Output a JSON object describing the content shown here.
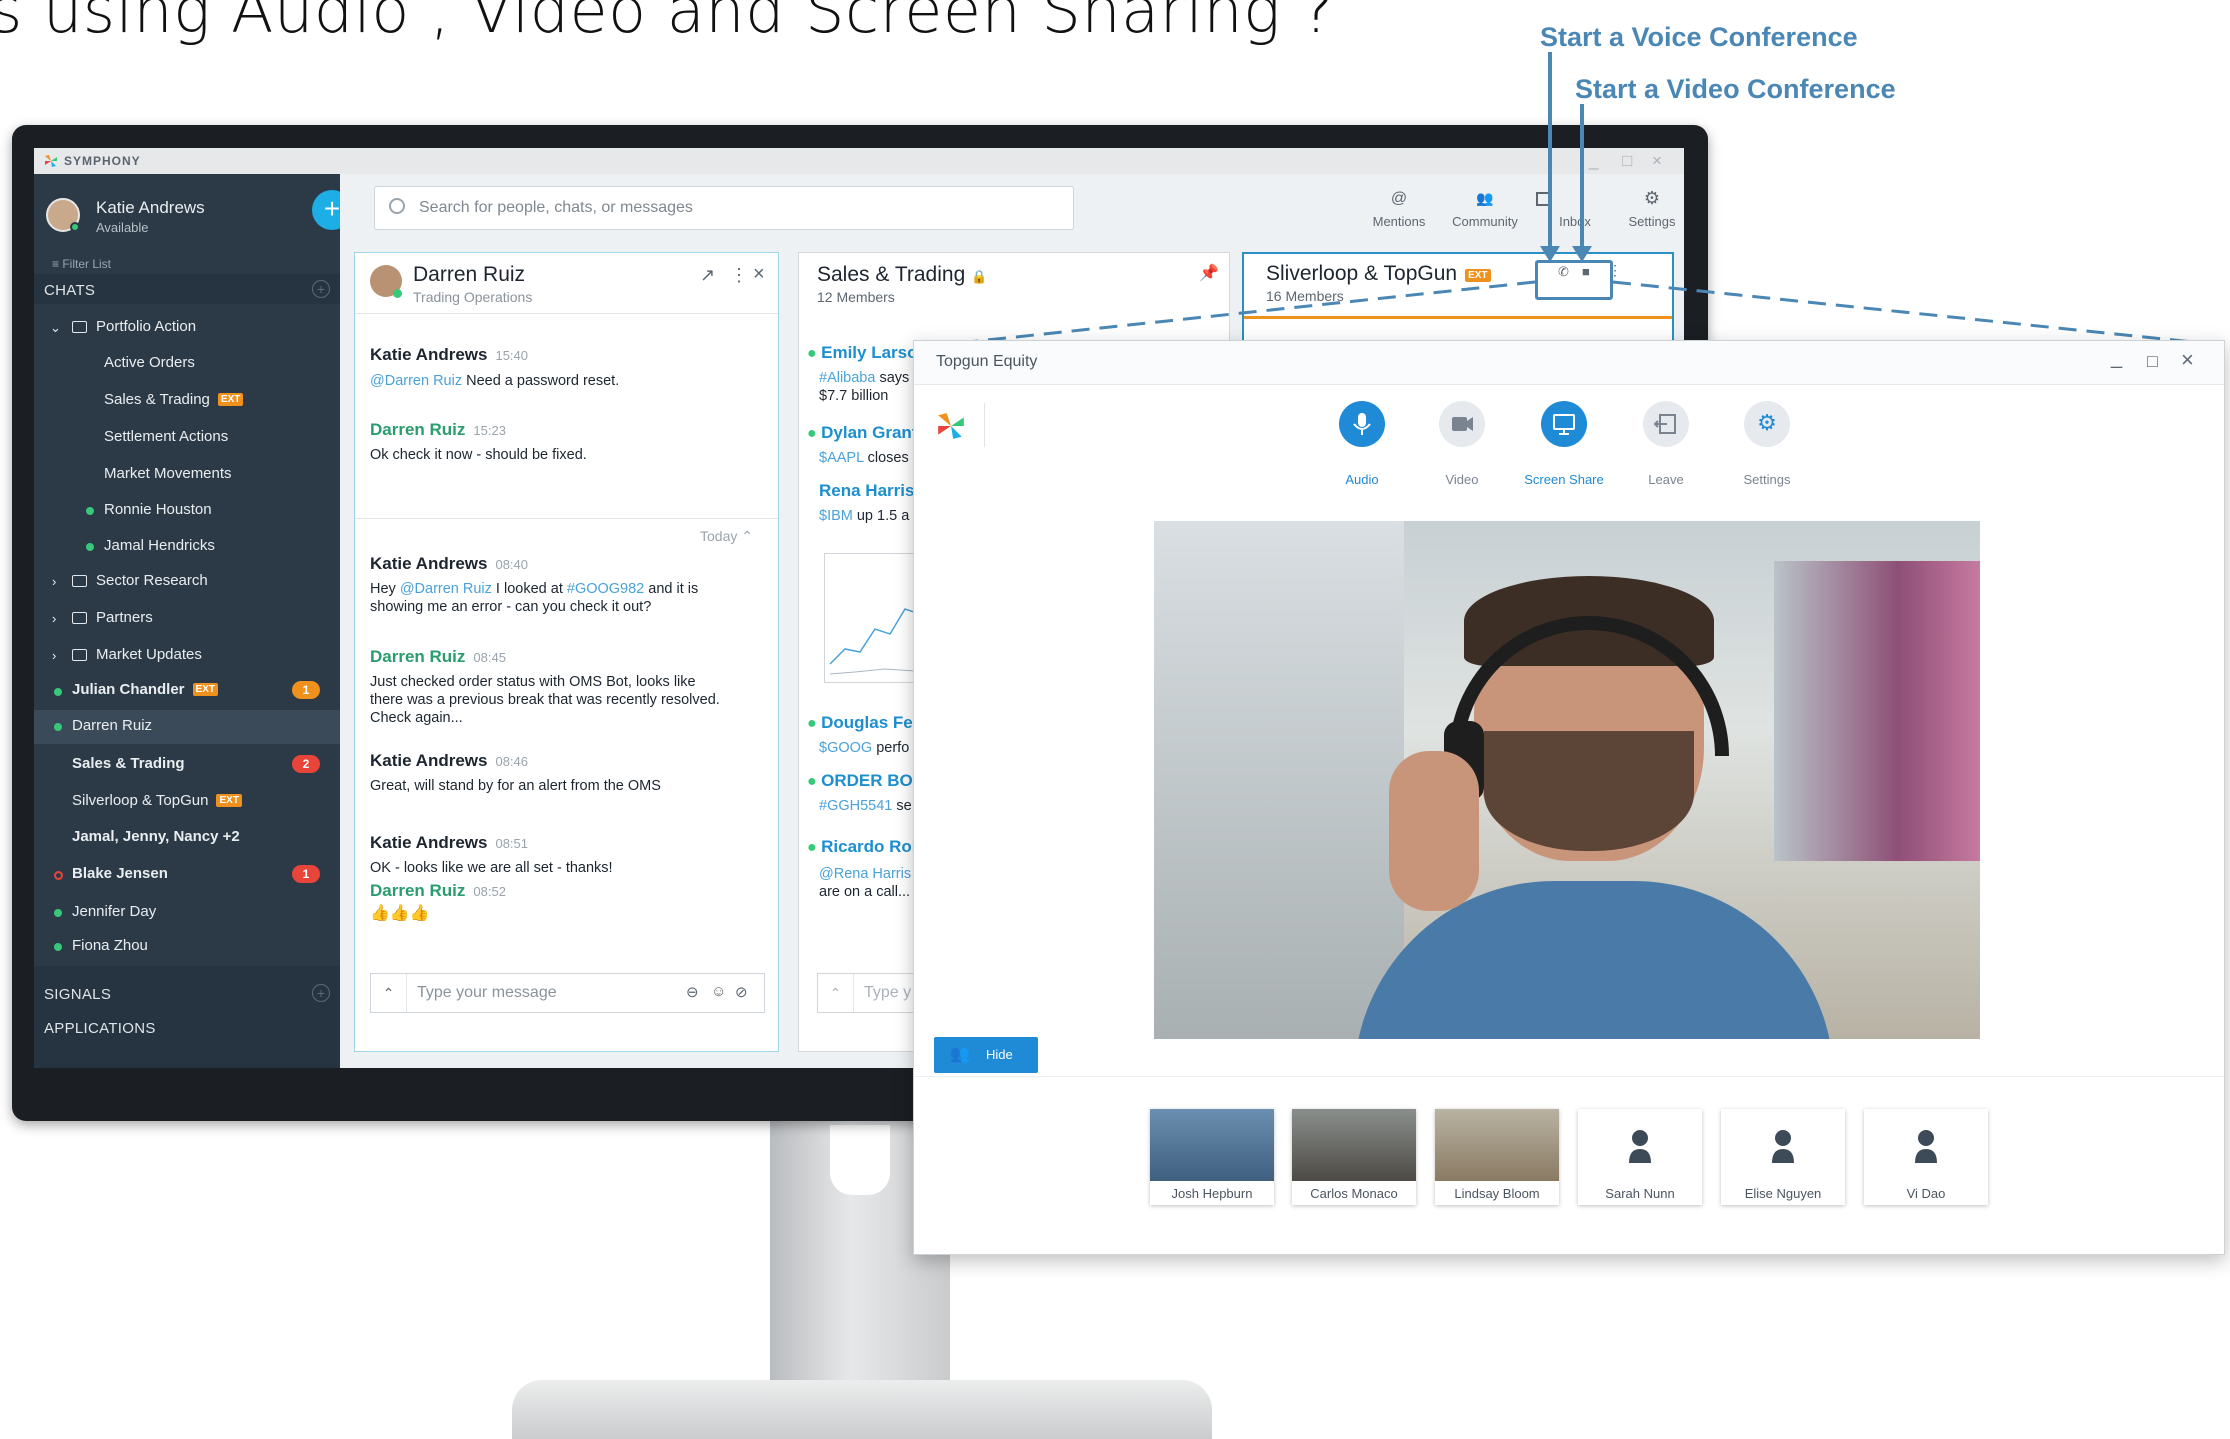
{
  "headline": "s using Audio , Video  and Screen Sharing ?",
  "annotations": {
    "voice": "Start a Voice Conference",
    "video": "Start a Video Conference"
  },
  "colors": {
    "sidebar": "#2c3a47",
    "accent": "#1daee5",
    "annotation": "#4a87b5",
    "online": "#37c979",
    "badge": "#e8443a",
    "ext": "#f0911e"
  },
  "app": {
    "brand": "SYMPHONY",
    "user": {
      "name": "Katie Andrews",
      "status": "Available"
    },
    "search_placeholder": "Search for people, chats, or messages",
    "toolbar": [
      {
        "label": "Mentions",
        "icon": "at-icon"
      },
      {
        "label": "Community",
        "icon": "people-icon"
      },
      {
        "label": "Inbox",
        "icon": "inbox-icon"
      },
      {
        "label": "Settings",
        "icon": "gear-icon"
      }
    ]
  },
  "sidebar": {
    "filter": "Filter List",
    "chats_header": "CHATS",
    "folder": "Portfolio Action",
    "folder_items": [
      "Active Orders",
      "Sales & Trading",
      "Settlement Actions",
      "Market Movements",
      "Ronnie Houston",
      "Jamal Hendricks"
    ],
    "folders": [
      "Sector Research",
      "Partners",
      "Market Updates"
    ],
    "chats": [
      {
        "name": "Julian Chandler",
        "ext": "EXT",
        "badge": "1"
      },
      {
        "name": "Darren Ruiz"
      },
      {
        "name": "Sales & Trading",
        "badge": "2"
      },
      {
        "name": "Silverloop & TopGun",
        "ext": "EXT"
      },
      {
        "name": "Jamal, Jenny, Nancy +2"
      },
      {
        "name": "Blake Jensen",
        "badge": "1"
      },
      {
        "name": "Jennifer Day"
      },
      {
        "name": "Fiona Zhou"
      }
    ],
    "signals_header": "SIGNALS",
    "applications_header": "APPLICATIONS",
    "ext_label": "EXT"
  },
  "chat1": {
    "name": "Darren Ruiz",
    "subtitle": "Trading Operations",
    "messages_top": [
      {
        "author": "Katie Andrews",
        "time": "15:40",
        "mention": "@Darren Ruiz",
        "text": " Need a password reset."
      },
      {
        "author": "Darren Ruiz",
        "time": "15:23",
        "text": "Ok check it now - should be fixed."
      }
    ],
    "divider": "Today",
    "messages": [
      {
        "author": "Katie Andrews",
        "time": "08:40"
      },
      {
        "author": "Darren Ruiz",
        "time": "08:45",
        "line1": "Just checked order status with OMS Bot, looks like",
        "line2": "there was a previous break that was recently resolved.",
        "line3": "Check again..."
      },
      {
        "author": "Katie Andrews",
        "time": "08:46",
        "line1": "Great, will stand by for an alert from the OMS"
      },
      {
        "author": "Katie Andrews",
        "time": "08:51",
        "line1": "OK - looks like we are all set - thanks!"
      },
      {
        "author": "Darren Ruiz",
        "time": "08:52",
        "line1": "👍👍👍"
      }
    ],
    "m3": {
      "hey": "Hey ",
      "mention": "@Darren Ruiz",
      "mid": " I looked at ",
      "tag": "#GOOG982",
      "end": " and it is",
      "line2": "showing me an error - can you check it out?"
    },
    "input_placeholder": "Type your message"
  },
  "chat2": {
    "name": "Sales & Trading",
    "members": "12 Members",
    "entries": [
      {
        "author": "Emily Larson",
        "tag": "#Alibaba",
        "rest": " says",
        "line2": "$7.7 billion"
      },
      {
        "author": "Dylan Grant",
        "tag": "$AAPL",
        "rest": " closes"
      },
      {
        "author": "Rena Harris",
        "tag": "$IBM",
        "rest": " up 1.5 a"
      },
      {
        "author": "Douglas Fer",
        "tag": "$GOOG",
        "rest": " perfo"
      },
      {
        "author": "ORDER BOT",
        "tag": "#GGH5541",
        "rest": " se"
      },
      {
        "author": "Ricardo Rob",
        "tag": "@Rena Harris",
        "rest": "",
        "line2": "are on a call..."
      }
    ],
    "input_placeholder": "Type y"
  },
  "chat3": {
    "name": "Sliverloop & TopGun",
    "members": "16 Members"
  },
  "popup": {
    "title": "Topgun Equity",
    "controls": [
      {
        "label": "Audio",
        "icon": "microphone-icon",
        "active": true
      },
      {
        "label": "Video",
        "icon": "video-camera-icon",
        "active": false
      },
      {
        "label": "Screen Share",
        "icon": "monitor-icon",
        "active": true
      },
      {
        "label": "Leave",
        "icon": "leave-icon",
        "active": false
      },
      {
        "label": "Settings",
        "icon": "gear-icon",
        "active": false
      }
    ],
    "hide_label": "Hide",
    "participants": [
      "Josh Hepburn",
      "Carlos Monaco",
      "Lindsay Bloom",
      "Sarah Nunn",
      "Elise Nguyen",
      "Vi Dao"
    ]
  }
}
